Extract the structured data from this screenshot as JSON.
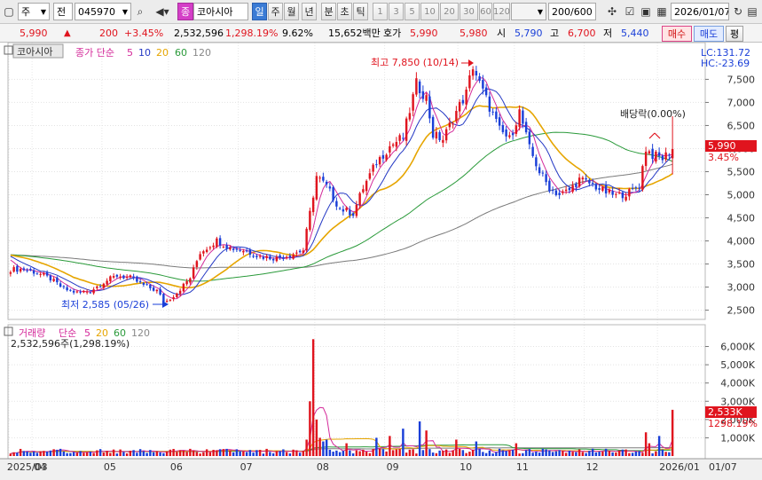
{
  "toolbar": {
    "type_label": "주",
    "market_label": "전",
    "code_value": "045970",
    "stock_badge": "종",
    "stock_name": "코아시아",
    "period_tabs": [
      "일",
      "주",
      "월",
      "년",
      "분",
      "초",
      "틱"
    ],
    "period_selected": "일",
    "interval_buttons": [
      "1",
      "3",
      "5",
      "10",
      "20",
      "30",
      "60",
      "120"
    ],
    "count_value": "200",
    "count_total": "/600",
    "date_value": "2026/01/07"
  },
  "quote": {
    "price": "5,990",
    "change_arrow": "▲",
    "change": "200",
    "change_pct": "+3.45%",
    "volume": "2,532,596",
    "volume_ratio": "1,298.19%",
    "turnover": "9.62%",
    "amount": "15,652백만",
    "ask_label": "호가",
    "ask": "5,990",
    "bid": "5,980",
    "open_label": "시",
    "open": "5,790",
    "high_label": "고",
    "high": "6,700",
    "low_label": "저",
    "low": "5,440",
    "buy_label": "매수",
    "sell_label": "매도",
    "eval_label": "평"
  },
  "price_panel": {
    "stock_tag": "코아시아",
    "ma_caption": "종가 단순",
    "ma_periods": [
      "5",
      "10",
      "20",
      "60",
      "120"
    ],
    "lc_label": "LC:131.72",
    "hc_label": "HC:-23.69",
    "high_annotation": "최고 7,850 (10/14)",
    "low_annotation": "최저 2,585 (05/26)",
    "dividend_annotation": "배당락(0.00%)",
    "last_price_tag": "5,990",
    "last_change_tag": "3.45%",
    "y_ticks": [
      "7,500",
      "7,000",
      "6,500",
      "6,000",
      "5,500",
      "5,000",
      "4,500",
      "4,000",
      "3,500",
      "3,000",
      "2,500"
    ]
  },
  "volume_panel": {
    "title": "거래량",
    "ma_caption": "단순",
    "ma_periods": [
      "5",
      "20",
      "60",
      "120"
    ],
    "summary": "2,532,596주(1,298.19%)",
    "last_volume_tag": "2,533K",
    "last_ratio_tag": "1298.19%",
    "y_ticks": [
      "6,000K",
      "5,000K",
      "4,000K",
      "3,000K",
      "2,000K",
      "1,000K"
    ]
  },
  "x_axis": {
    "labels": [
      "2025/03",
      "04",
      "05",
      "06",
      "07",
      "08",
      "09",
      "10",
      "11",
      "12",
      "2026/01",
      "01/07"
    ]
  },
  "colors": {
    "up": "#e0141e",
    "down": "#1a3fd8",
    "ma5": "#d42a9a",
    "ma10": "#2438c4",
    "ma20": "#e6a500",
    "ma60": "#2a9a3a",
    "ma120": "#7a7a7a"
  },
  "chart_data": {
    "type": "candlestick",
    "price_range": [
      2300,
      7950
    ],
    "volume_range": [
      0,
      6900000
    ],
    "month_starts": {
      "2025/03": 0,
      "04": 7,
      "05": 28,
      "06": 48,
      "07": 69,
      "08": 92,
      "09": 113,
      "10": 135,
      "11": 152,
      "12": 173,
      "2026/01": 195
    },
    "anchors": [
      [
        0,
        3380
      ],
      [
        4,
        3390
      ],
      [
        8,
        3310
      ],
      [
        12,
        3180
      ],
      [
        16,
        2960
      ],
      [
        20,
        2880
      ],
      [
        24,
        2920
      ],
      [
        28,
        3110
      ],
      [
        32,
        3250
      ],
      [
        36,
        3200
      ],
      [
        40,
        3040
      ],
      [
        44,
        2920
      ],
      [
        46,
        2700
      ],
      [
        47,
        2700
      ],
      [
        50,
        2880
      ],
      [
        54,
        3200
      ],
      [
        57,
        3750
      ],
      [
        62,
        4010
      ],
      [
        66,
        3850
      ],
      [
        70,
        3800
      ],
      [
        75,
        3660
      ],
      [
        80,
        3630
      ],
      [
        84,
        3700
      ],
      [
        88,
        3800
      ],
      [
        90,
        4600
      ],
      [
        92,
        5400
      ],
      [
        95,
        5180
      ],
      [
        99,
        4700
      ],
      [
        103,
        4600
      ],
      [
        106,
        5150
      ],
      [
        110,
        5700
      ],
      [
        114,
        6050
      ],
      [
        118,
        6250
      ],
      [
        122,
        7400
      ],
      [
        125,
        7100
      ],
      [
        127,
        6300
      ],
      [
        130,
        6200
      ],
      [
        134,
        6800
      ],
      [
        137,
        7200
      ],
      [
        139,
        7800
      ],
      [
        141,
        7400
      ],
      [
        144,
        6900
      ],
      [
        147,
        6400
      ],
      [
        150,
        6200
      ],
      [
        153,
        6800
      ],
      [
        156,
        6000
      ],
      [
        159,
        5500
      ],
      [
        162,
        5150
      ],
      [
        165,
        5000
      ],
      [
        168,
        5100
      ],
      [
        171,
        5330
      ],
      [
        175,
        5220
      ],
      [
        178,
        5080
      ],
      [
        182,
        4980
      ],
      [
        186,
        5050
      ],
      [
        189,
        5200
      ],
      [
        191,
        6000
      ],
      [
        193,
        5860
      ],
      [
        196,
        5790
      ],
      [
        199,
        5990
      ]
    ],
    "volume_spikes": [
      [
        5,
        250000
      ],
      [
        12,
        300000
      ],
      [
        19,
        220000
      ],
      [
        27,
        380000
      ],
      [
        45,
        200000
      ],
      [
        55,
        300000
      ],
      [
        62,
        320000
      ],
      [
        69,
        260000
      ],
      [
        85,
        350000
      ],
      [
        89,
        900000
      ],
      [
        90,
        3000000
      ],
      [
        91,
        6400000
      ],
      [
        92,
        2000000
      ],
      [
        93,
        1000000
      ],
      [
        94,
        800000
      ],
      [
        95,
        900000
      ],
      [
        101,
        700000
      ],
      [
        110,
        1000000
      ],
      [
        114,
        1100000
      ],
      [
        118,
        1500000
      ],
      [
        123,
        1900000
      ],
      [
        125,
        1400000
      ],
      [
        134,
        900000
      ],
      [
        140,
        800000
      ],
      [
        152,
        700000
      ],
      [
        160,
        400000
      ],
      [
        188,
        250000
      ],
      [
        191,
        1300000
      ],
      [
        192,
        700000
      ],
      [
        195,
        1100000
      ],
      [
        199,
        2532596
      ]
    ],
    "base_volume": 270000,
    "max_annotation": {
      "label": "최고 7,850 (10/14)",
      "value": 7850
    },
    "min_annotation": {
      "label": "최저 2,585 (05/26)",
      "value": 2585
    }
  }
}
